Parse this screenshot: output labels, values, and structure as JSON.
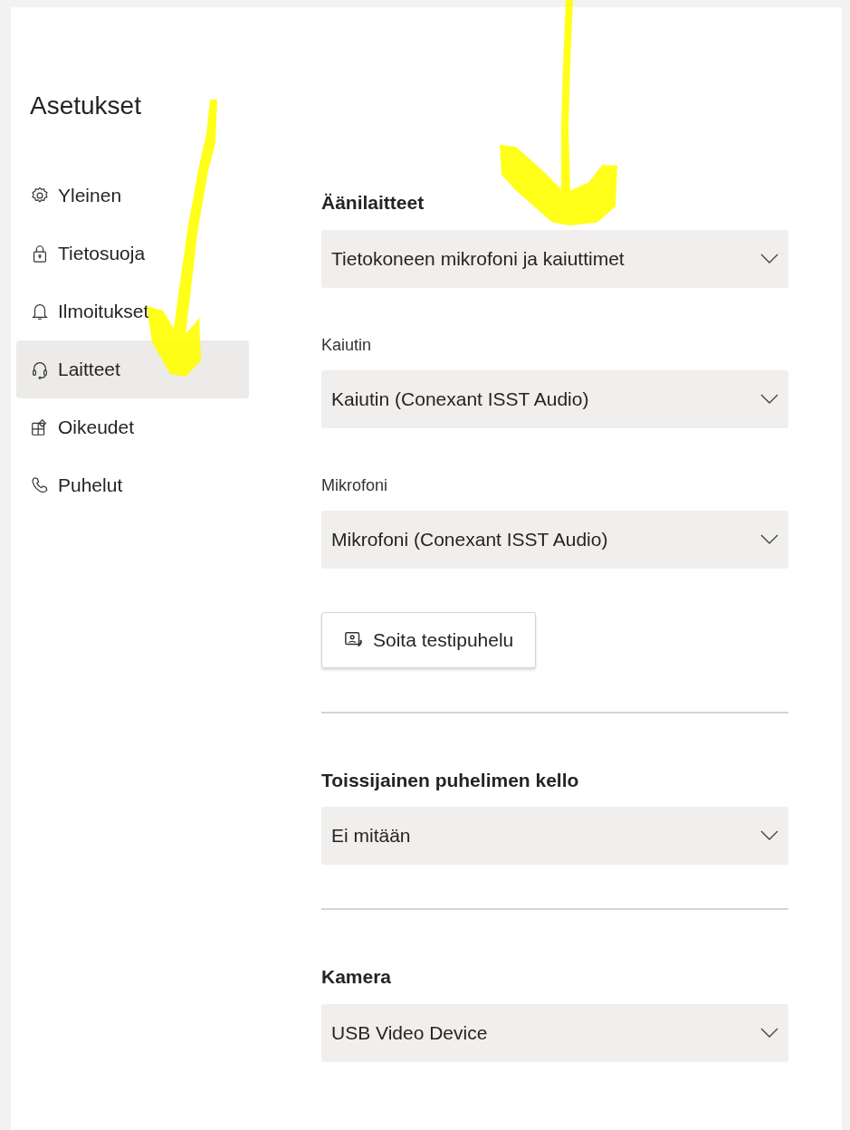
{
  "title": "Asetukset",
  "sidebar": {
    "items": [
      {
        "label": "Yleinen",
        "selected": false
      },
      {
        "label": "Tietosuoja",
        "selected": false
      },
      {
        "label": "Ilmoitukset",
        "selected": false
      },
      {
        "label": "Laitteet",
        "selected": true
      },
      {
        "label": "Oikeudet",
        "selected": false
      },
      {
        "label": "Puhelut",
        "selected": false
      }
    ]
  },
  "sections": [
    {
      "heading": "Äänilaitteet",
      "fields": [
        {
          "kind": "dropdown",
          "value": "Tietokoneen mikrofoni ja kaiuttimet"
        },
        {
          "kind": "dropdown",
          "label": "Kaiutin",
          "value": "Kaiutin (Conexant ISST Audio)"
        },
        {
          "kind": "dropdown",
          "label": "Mikrofoni",
          "value": "Mikrofoni (Conexant ISST Audio)"
        },
        {
          "kind": "button",
          "value": "Soita testipuhelu"
        }
      ]
    },
    {
      "heading": "Toissijainen puhelimen kello",
      "fields": [
        {
          "kind": "dropdown",
          "value": "Ei mitään"
        }
      ]
    },
    {
      "heading": "Kamera",
      "fields": [
        {
          "kind": "dropdown",
          "value": "USB Video Device"
        }
      ]
    }
  ]
}
